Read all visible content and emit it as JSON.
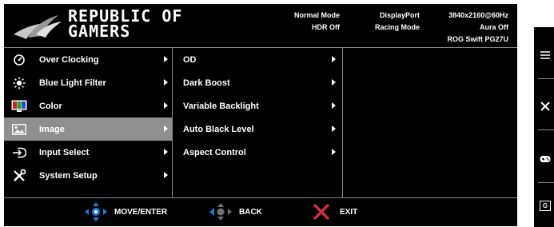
{
  "brand": {
    "line1": "REPUBLIC OF",
    "line2": "GAMERS"
  },
  "status": {
    "col1": [
      "Normal Mode",
      "HDR Off"
    ],
    "col2": [
      "DisplayPort",
      "Racing Mode"
    ],
    "col3": [
      "3840x2160@60Hz",
      "Aura Off",
      "ROG Swift PG27U"
    ]
  },
  "main_menu": [
    {
      "label": "Over Clocking",
      "icon": "speedometer-icon"
    },
    {
      "label": "Blue Light Filter",
      "icon": "bulb-icon"
    },
    {
      "label": "Color",
      "icon": "color-icon"
    },
    {
      "label": "Image",
      "icon": "image-icon",
      "selected": true
    },
    {
      "label": "Input Select",
      "icon": "input-icon"
    },
    {
      "label": "System Setup",
      "icon": "tools-icon"
    }
  ],
  "sub_menu": [
    {
      "label": "OD"
    },
    {
      "label": "Dark Boost"
    },
    {
      "label": "Variable Backlight"
    },
    {
      "label": "Auto Black Level"
    },
    {
      "label": "Aspect Control"
    }
  ],
  "footer": {
    "move": "MOVE/ENTER",
    "back": "BACK",
    "exit": "EXIT"
  },
  "side_keys": {
    "g_label": "G"
  },
  "colors": {
    "background": "#000000",
    "selected": "#8f8f8f",
    "divider": "#8a8a8a",
    "text": "#ffffff"
  }
}
